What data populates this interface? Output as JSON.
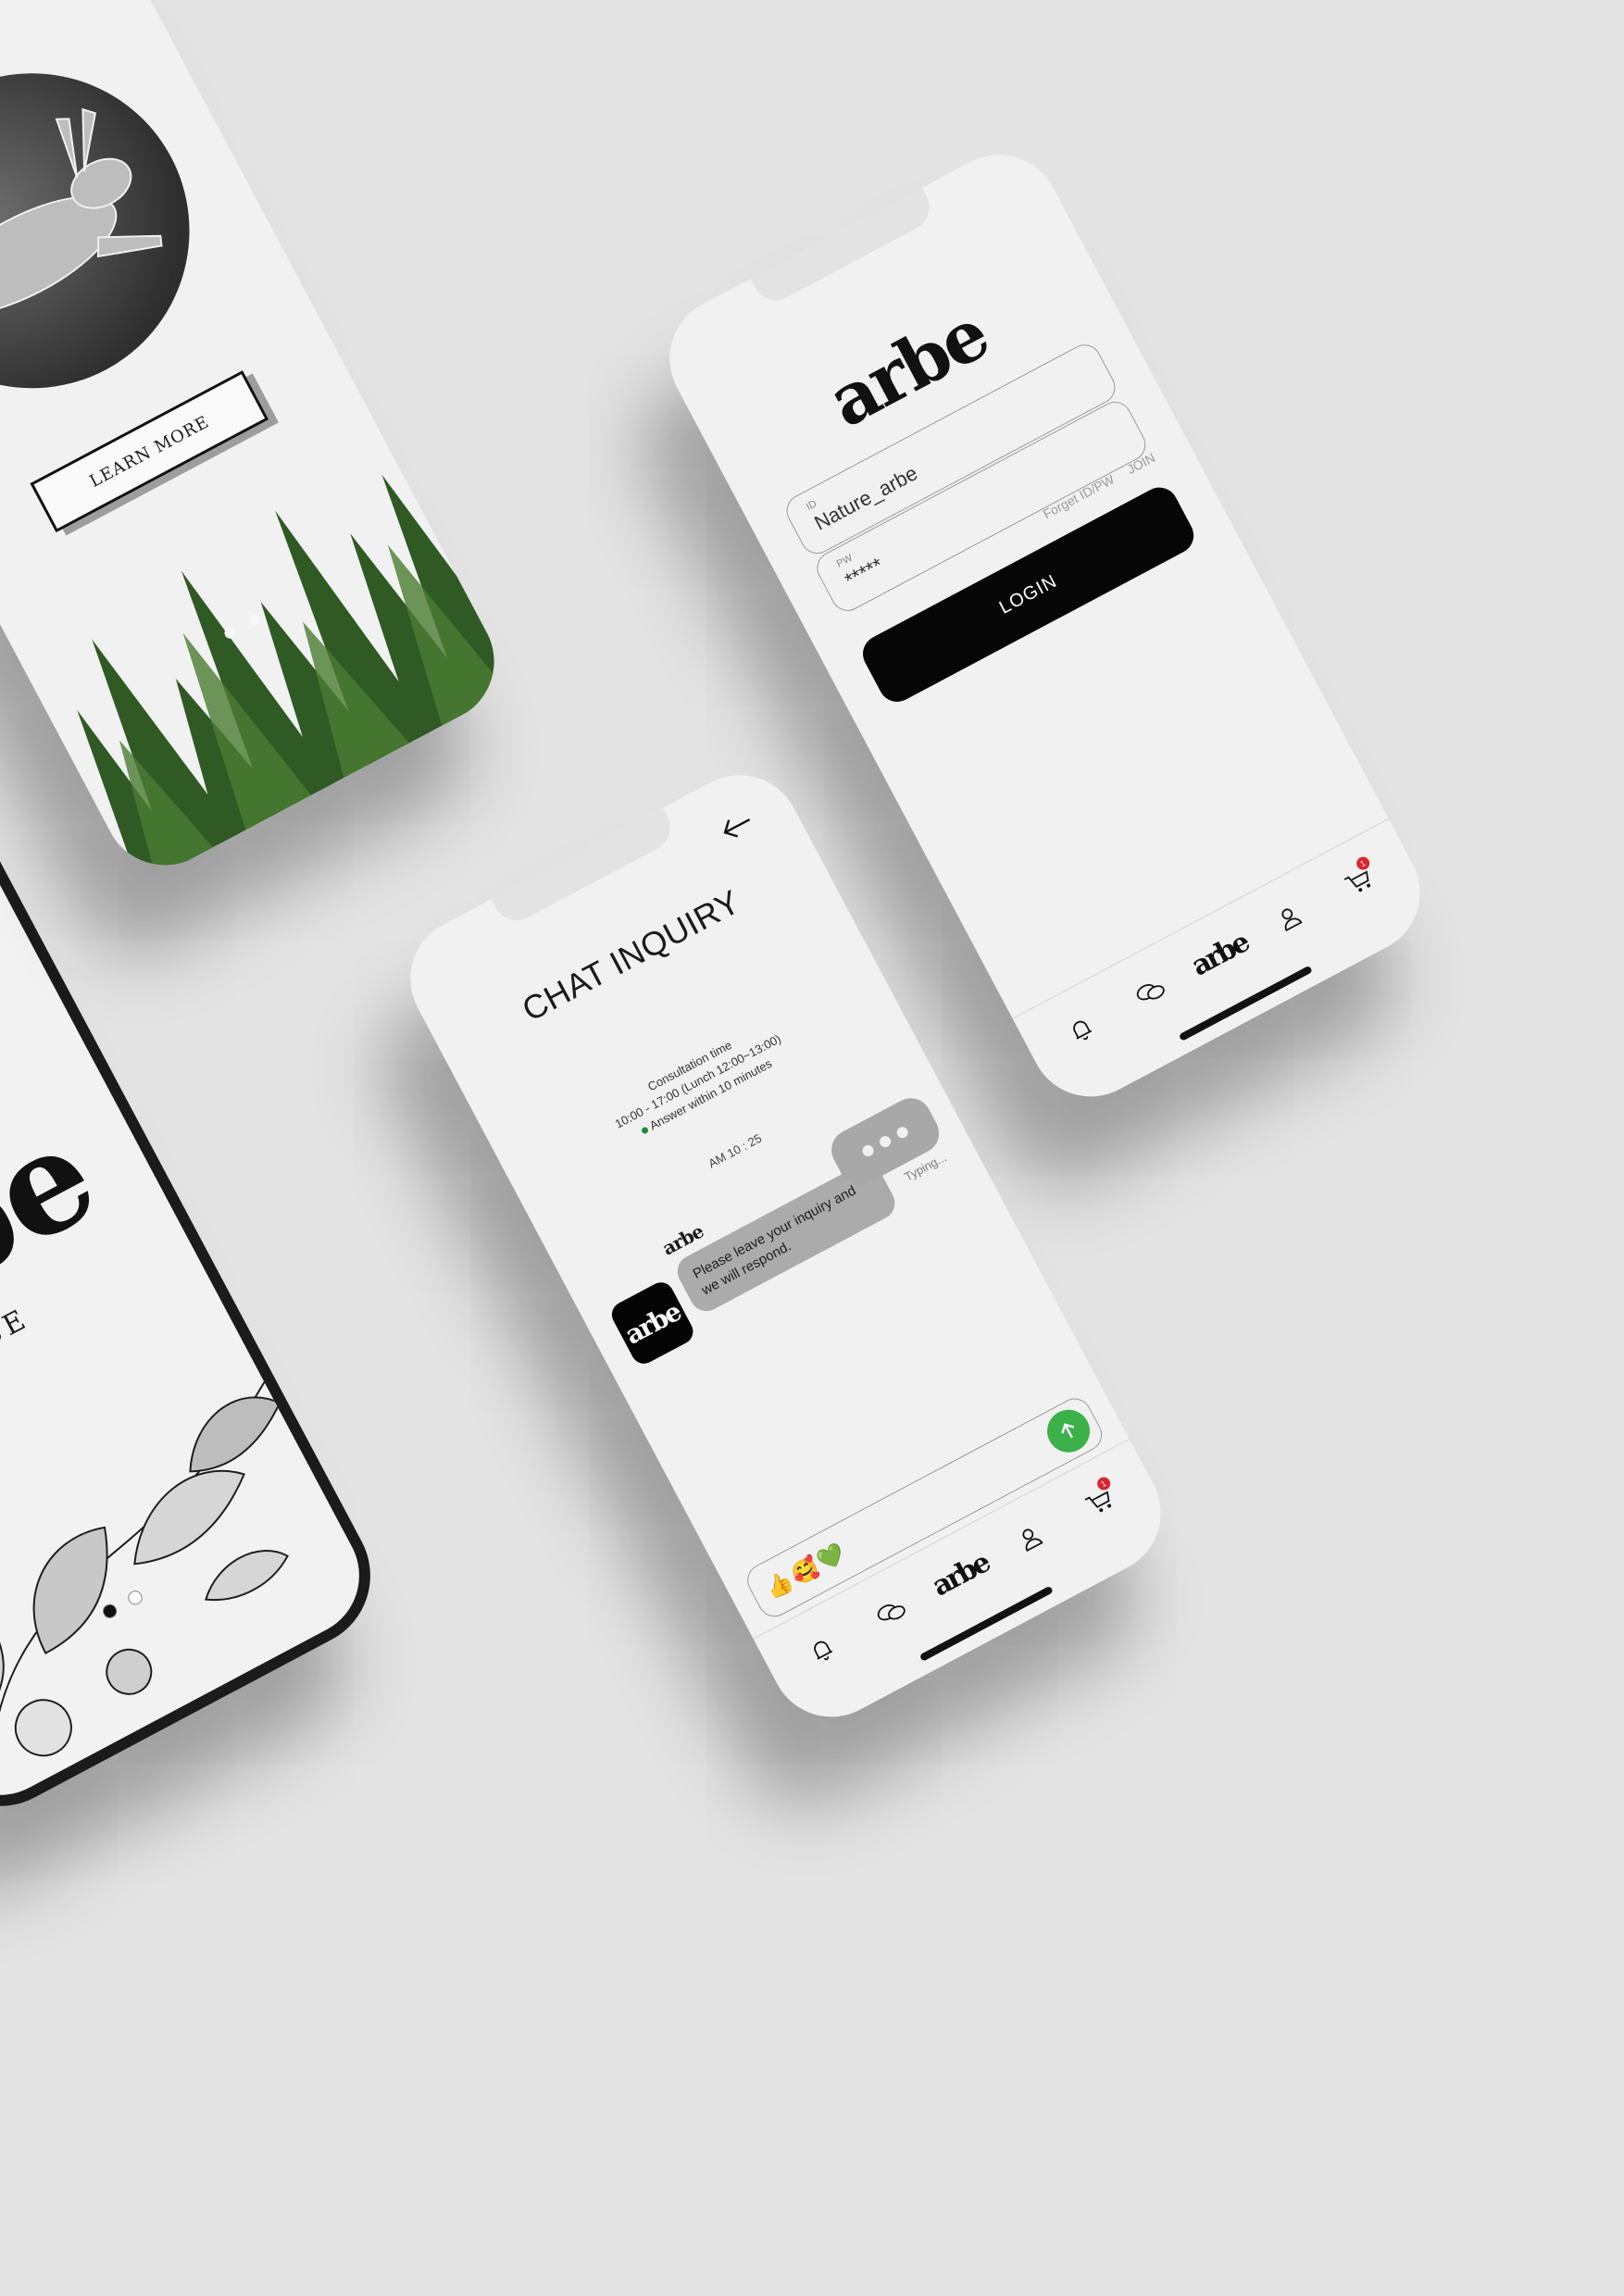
{
  "brand": {
    "monogram": "arbe",
    "strip_text": "ARBE arbe",
    "wordmark": "ARBE"
  },
  "hare_screen": {
    "learn_more_label": "LEARN MORE",
    "pager": {
      "count": 2,
      "active_index": 0
    }
  },
  "login_screen": {
    "id_field": {
      "label": "ID",
      "value": "Nature_arbe"
    },
    "pw_field": {
      "label": "PW",
      "value": "*****"
    },
    "forgot_link": "Forget ID/PW",
    "join_link": "JOIN",
    "login_button": "LOGIN"
  },
  "chat_screen": {
    "title": "CHAT INQUIRY",
    "consultation_label": "Consultation time",
    "consultation_hours": "10:00 - 17:00 (Lunch 12:00~13:00)",
    "response_note": "Answer within 10 minutes",
    "message_time": "AM 10 : 25",
    "sender_name": "arbe",
    "avatar_text": "arbe",
    "message_text": "Please leave your inquiry and we will respond.",
    "typing_label": "Typing...",
    "emoji_reactions": [
      "👍",
      "🥰",
      "💚"
    ]
  },
  "tabbar": {
    "items": [
      {
        "name": "notifications",
        "icon": "bell-icon"
      },
      {
        "name": "chat",
        "icon": "chat-bubbles-icon"
      },
      {
        "name": "home",
        "icon": "arbe-logo-icon"
      },
      {
        "name": "account",
        "icon": "person-icon"
      },
      {
        "name": "cart",
        "icon": "cart-icon",
        "badge": "1"
      }
    ]
  },
  "colors": {
    "background": "#e3e3e3",
    "screen": "#f1f1f1",
    "primary_button": "#060606",
    "send_button": "#3cb14a",
    "badge": "#d9262c",
    "status_dot": "#1c8b3a",
    "incoming_bubble": "#ababab"
  }
}
